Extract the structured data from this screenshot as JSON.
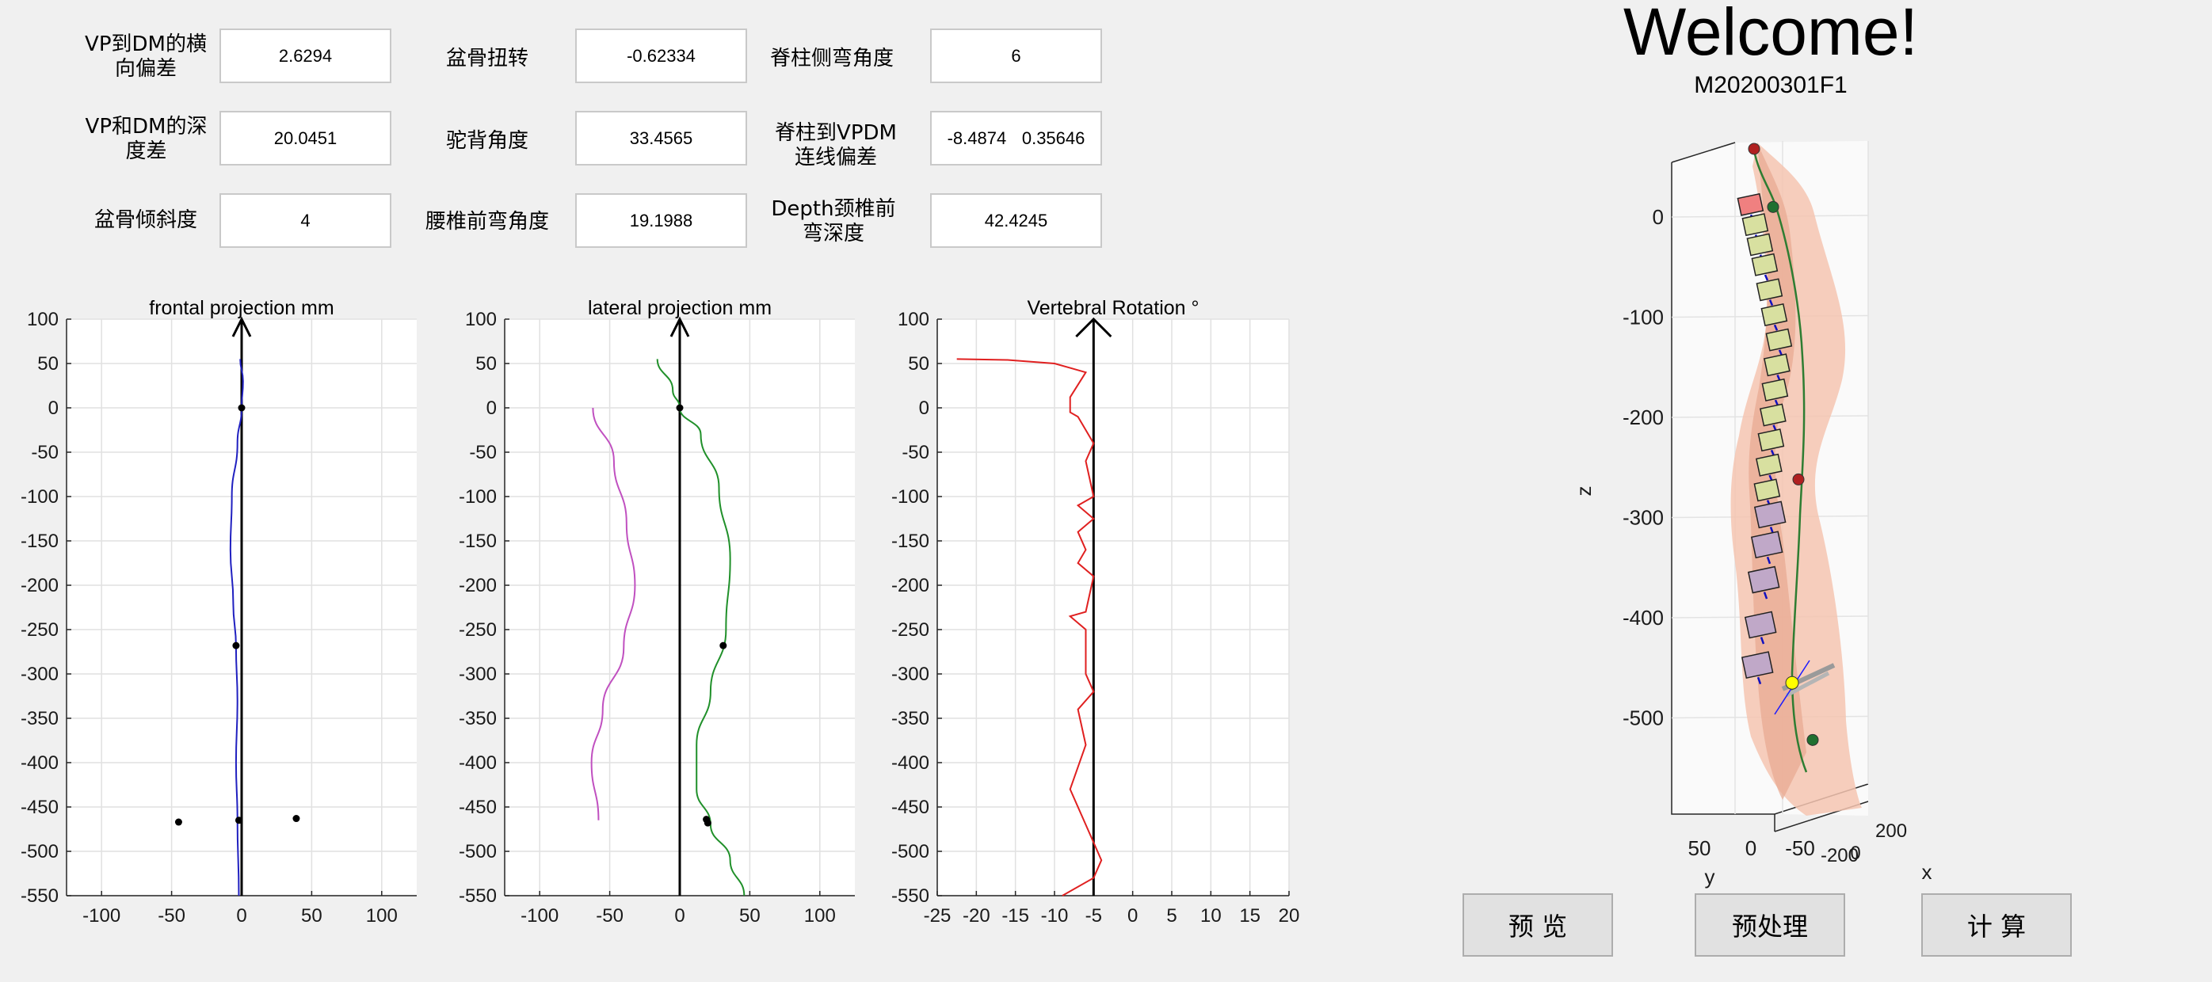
{
  "params": {
    "vp_dm_lateral_offset": {
      "label": "VP到DM的横向偏差",
      "value": "2.6294"
    },
    "pelvic_torsion": {
      "label": "盆骨扭转",
      "value": "-0.62334"
    },
    "scoliosis_angle": {
      "label": "脊柱侧弯角度",
      "value": "6"
    },
    "vp_dm_depth_diff": {
      "label": "VP和DM的深度差",
      "value": "20.0451"
    },
    "kyphosis_angle": {
      "label": "驼背角度",
      "value": "33.4565"
    },
    "spine_vpdm_offset": {
      "label": "脊柱到VPDM连线偏差",
      "value1": "-8.4874",
      "value2": "0.35646"
    },
    "pelvic_tilt": {
      "label": "盆骨倾斜度",
      "value": "4"
    },
    "lumbar_lordosis_angle": {
      "label": "腰椎前弯角度",
      "value": "19.1988"
    },
    "cervical_lordosis_depth": {
      "label": "Depth颈椎前弯深度",
      "value": "42.4245"
    }
  },
  "header": {
    "welcome": "Welcome!",
    "file_id": "M20200301F1"
  },
  "buttons": {
    "preview": "预  览",
    "preprocess": "预处理",
    "compute": "计  算"
  },
  "chart_data": [
    {
      "type": "line",
      "title": "frontal projection mm",
      "xlim": [
        -125,
        125
      ],
      "ylim": [
        -550,
        100
      ],
      "xticks": [
        -100,
        -50,
        0,
        50,
        100
      ],
      "yticks": [
        100,
        50,
        0,
        -50,
        -100,
        -150,
        -200,
        -250,
        -300,
        -350,
        -400,
        -450,
        -500,
        -550
      ],
      "grid": true,
      "color": "#2020c0",
      "reference_axis_x": 0,
      "series": [
        {
          "values": [
            [
              -1,
              55
            ],
            [
              1,
              30
            ],
            [
              0,
              0
            ],
            [
              -3,
              -40
            ],
            [
              -7,
              -100
            ],
            [
              -8,
              -160
            ],
            [
              -6,
              -220
            ],
            [
              -4,
              -270
            ],
            [
              -3,
              -330
            ],
            [
              -4,
              -400
            ],
            [
              -3,
              -465
            ],
            [
              -2,
              -550
            ]
          ]
        }
      ],
      "points": [
        [
          0,
          0
        ],
        [
          -4,
          -268
        ],
        [
          -2,
          -465
        ],
        [
          -45,
          -467
        ],
        [
          39,
          -463
        ]
      ]
    },
    {
      "type": "line",
      "title": "lateral projection mm",
      "xlim": [
        -125,
        125
      ],
      "ylim": [
        -550,
        100
      ],
      "xticks": [
        -100,
        -50,
        0,
        50,
        100
      ],
      "yticks": [
        100,
        50,
        0,
        -50,
        -100,
        -150,
        -200,
        -250,
        -300,
        -350,
        -400,
        -450,
        -500,
        -550
      ],
      "grid": true,
      "reference_axis_x": 0,
      "series": [
        {
          "color": "#c050c0",
          "values": [
            [
              -62,
              0
            ],
            [
              -47,
              -60
            ],
            [
              -38,
              -130
            ],
            [
              -32,
              -200
            ],
            [
              -40,
              -270
            ],
            [
              -55,
              -340
            ],
            [
              -63,
              -400
            ],
            [
              -58,
              -465
            ]
          ]
        },
        {
          "color": "#20902a",
          "values": [
            [
              -16,
              55
            ],
            [
              -5,
              20
            ],
            [
              0,
              0
            ],
            [
              15,
              -30
            ],
            [
              28,
              -90
            ],
            [
              36,
              -170
            ],
            [
              33,
              -250
            ],
            [
              22,
              -320
            ],
            [
              12,
              -380
            ],
            [
              12,
              -430
            ],
            [
              22,
              -470
            ],
            [
              36,
              -510
            ],
            [
              46,
              -550
            ]
          ]
        }
      ],
      "points": [
        [
          0,
          0
        ],
        [
          31,
          -268
        ],
        [
          19,
          -464
        ],
        [
          20,
          -468
        ]
      ]
    },
    {
      "type": "line",
      "title": "Vertebral Rotation °",
      "xlim": [
        -25,
        20
      ],
      "ylim": [
        -550,
        100
      ],
      "xticks": [
        -25,
        -20,
        -15,
        -10,
        -5,
        0,
        5,
        10,
        15,
        20
      ],
      "yticks": [
        100,
        50,
        0,
        -50,
        -100,
        -150,
        -200,
        -250,
        -300,
        -350,
        -400,
        -450,
        -500,
        -550
      ],
      "grid": true,
      "color": "#e02020",
      "reference_axis_x": -5,
      "series": [
        {
          "values": [
            [
              -22.5,
              55
            ],
            [
              -16,
              54
            ],
            [
              -10,
              50
            ],
            [
              -8,
              45
            ],
            [
              -6,
              40
            ],
            [
              -8,
              12
            ],
            [
              -8,
              -5
            ],
            [
              -7,
              -10
            ],
            [
              -6,
              -25
            ],
            [
              -5,
              -40
            ],
            [
              -6,
              -60
            ],
            [
              -5,
              -100
            ],
            [
              -7,
              -110
            ],
            [
              -5,
              -125
            ],
            [
              -7,
              -140
            ],
            [
              -6,
              -160
            ],
            [
              -7,
              -175
            ],
            [
              -5,
              -190
            ],
            [
              -6,
              -230
            ],
            [
              -8,
              -235
            ],
            [
              -6,
              -250
            ],
            [
              -6,
              -300
            ],
            [
              -5,
              -320
            ],
            [
              -7,
              -340
            ],
            [
              -6,
              -380
            ],
            [
              -8,
              -430
            ],
            [
              -6,
              -470
            ],
            [
              -4,
              -510
            ],
            [
              -5,
              -530
            ],
            [
              -9,
              -550
            ]
          ]
        }
      ]
    },
    {
      "type": "scatter",
      "title": "",
      "zlabel": "z",
      "xlabel": "x",
      "ylabel": "y",
      "zticks": [
        0,
        -100,
        -200,
        -300,
        -400,
        -500
      ],
      "yticks": [
        50,
        0,
        -50
      ],
      "xticks": [
        200,
        0,
        -200
      ],
      "grid": true,
      "vertebrae": {
        "count": 18,
        "colors": {
          "top": "#f08080",
          "thoracic": "#d8e0a0",
          "lumbar": "#c0a8c8"
        },
        "z_values": [
          10,
          -10,
          -30,
          -50,
          -75,
          -100,
          -125,
          -150,
          -175,
          -200,
          -225,
          -250,
          -275,
          -300,
          -330,
          -365,
          -410,
          -450
        ]
      },
      "markers": [
        {
          "name": "top",
          "color": "#b02020",
          "z": 68
        },
        {
          "name": "c7",
          "color": "#207030",
          "z": 10
        },
        {
          "name": "mid",
          "color": "#b02020",
          "z": -262
        },
        {
          "name": "pelvis",
          "color": "#ffff00",
          "z": -465
        },
        {
          "name": "bottom",
          "color": "#207030",
          "z": -522
        }
      ]
    }
  ]
}
